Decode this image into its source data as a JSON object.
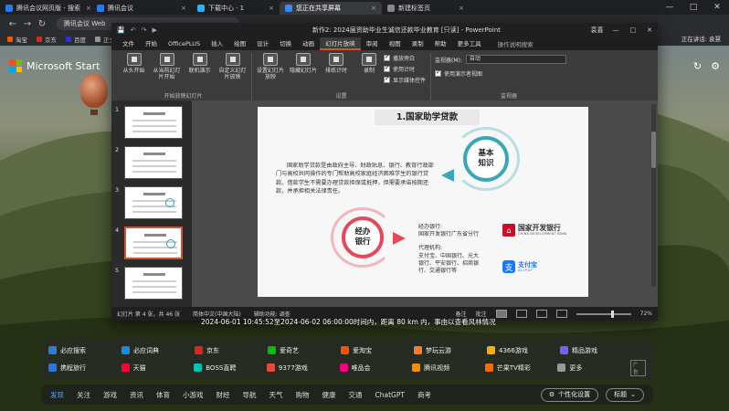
{
  "browser": {
    "tabs": [
      {
        "label": "腾讯会议网页版 - 搜索",
        "color": "#1f7bff",
        "active": false
      },
      {
        "label": "腾讯会议",
        "color": "#1f7bff",
        "active": false
      },
      {
        "label": "下载中心 · 1",
        "color": "#2db4ff",
        "active": false
      },
      {
        "label": "您正在共享屏幕",
        "color": "#3a89ff",
        "active": true
      },
      {
        "label": "新建标签页",
        "color": "#888888",
        "active": false
      }
    ],
    "url": "腾讯会议 Web",
    "bookmarks": [
      {
        "label": "淘宝",
        "color": "#ff5000"
      },
      {
        "label": "京东",
        "color": "#e1251b"
      },
      {
        "label": "百度",
        "color": "#2932e1"
      },
      {
        "label": "正文 长途电话",
        "color": "#999999"
      }
    ],
    "win_controls": [
      "—",
      "□",
      "✕"
    ]
  },
  "desktop": {
    "ms_start": "Microsoft Start",
    "right_icons": [
      "↻",
      "⚙"
    ]
  },
  "ppt": {
    "quick_access": [
      "💾",
      "↶",
      "↷",
      "▶"
    ],
    "doc_title": "新作2: 2024届资助毕业生诚信还款毕业教育 [只读] - PowerPoint",
    "user": "袁喜",
    "win_controls": [
      "—",
      "□",
      "✕"
    ],
    "menu": [
      "文件",
      "开始",
      "OfficePLUS",
      "插入",
      "绘图",
      "设计",
      "切换",
      "动画",
      "幻灯片放映",
      "审阅",
      "视图",
      "录制",
      "帮助",
      "更多工具"
    ],
    "active_menu": "幻灯片放映",
    "search_placeholder": "操作说明搜索",
    "ribbon": {
      "start_group": {
        "buttons": [
          "从头开始",
          "从当前幻灯片开始",
          "联机演示",
          "自定义幻灯片放映"
        ],
        "label": "开始放映幻灯片"
      },
      "setup_group": {
        "buttons": [
          "设置幻灯片放映",
          "隐藏幻灯片",
          "排练计时",
          "录制"
        ],
        "checks": [
          {
            "label": "播放旁白",
            "checked": true
          },
          {
            "label": "使用计时",
            "checked": true
          },
          {
            "label": "显示媒体控件",
            "checked": true
          }
        ],
        "label": "设置"
      },
      "monitor_group": {
        "monitor_label": "监视器(M):",
        "monitor_value": "自动",
        "presenter_view": {
          "label": "使用演示者视图",
          "checked": true
        },
        "label": "监视器"
      }
    },
    "thumbnails": [
      "1",
      "2",
      "3",
      "4",
      "5"
    ],
    "selected_thumbnail": 3,
    "slide": {
      "title": "1.国家助学贷款",
      "body": "国家助学贷款是由政府主导、财政贴息、银行、教育行政部门与高校共同操作的专门帮助高校家庭经济困难学生的银行贷款。借款学生不需要办理贷款担保或抵押，但需要承诺按期还款，并承担相关法律责任。",
      "circle_basic": "基本\n知识",
      "circle_manage": "经办\n银行",
      "manager_heading": "经办银行:",
      "manager_value": "国家开发银行广东省分行",
      "agency_heading": "代理机构:",
      "agency_lines": [
        "支付宝、中国银行、光大",
        "银行、平安银行、招商银",
        "行、交通银行等"
      ],
      "bank_name": "国家开发银行",
      "bank_en": "CHINA DEVELOPMENT BANK",
      "alipay_name": "支付宝",
      "alipay_en": "ALIPAY"
    },
    "status": {
      "slide_info": "幻灯片 第 4 张，共 46 张",
      "language": "简体中文(中国大陆)",
      "accessibility": "辅助功能: 调查",
      "notes": "备注",
      "comments": "批注",
      "zoom": "72%"
    }
  },
  "share_chip": "正在讲话: 袁慧",
  "caption": "2024-06-01 10:45:52至2024-06-02 06:00:00时间内，距离   80 km 内，事由以查看风林情况",
  "apps_row1": [
    {
      "label": "必应搜索",
      "color": "#2f7bd8"
    },
    {
      "label": "必应词典",
      "color": "#1b8be0"
    },
    {
      "label": "京东",
      "color": "#e1251b"
    },
    {
      "label": "爱奇艺",
      "color": "#00be06"
    },
    {
      "label": "爱淘宝",
      "color": "#ff5000"
    },
    {
      "label": "梦玩云游",
      "color": "#ff7a2e"
    },
    {
      "label": "4366游戏",
      "color": "#f6b100"
    },
    {
      "label": "精品游戏",
      "color": "#7a5cff"
    }
  ],
  "apps_row2": [
    {
      "label": "携程旅行",
      "color": "#2577e3"
    },
    {
      "label": "天猫",
      "color": "#ff0036"
    },
    {
      "label": "BOSS直聘",
      "color": "#00c2b3"
    },
    {
      "label": "9377游戏",
      "color": "#e64b3c"
    },
    {
      "label": "唯品会",
      "color": "#f10180"
    },
    {
      "label": "腾讯视频",
      "color": "#ff8a00"
    },
    {
      "label": "芒果TV精彩",
      "color": "#ff6a00"
    },
    {
      "label": "更多",
      "color": "#999999"
    }
  ],
  "ad_tag": "广告",
  "newsnav": [
    "发现",
    "关注",
    "游戏",
    "资讯",
    "体育",
    "小游戏",
    "财经",
    "导航",
    "天气",
    "购物",
    "健康",
    "交通",
    "ChatGPT",
    "商考"
  ],
  "newsnav_active": "发现",
  "personalize": "个性化设置",
  "titles_label": "标题"
}
